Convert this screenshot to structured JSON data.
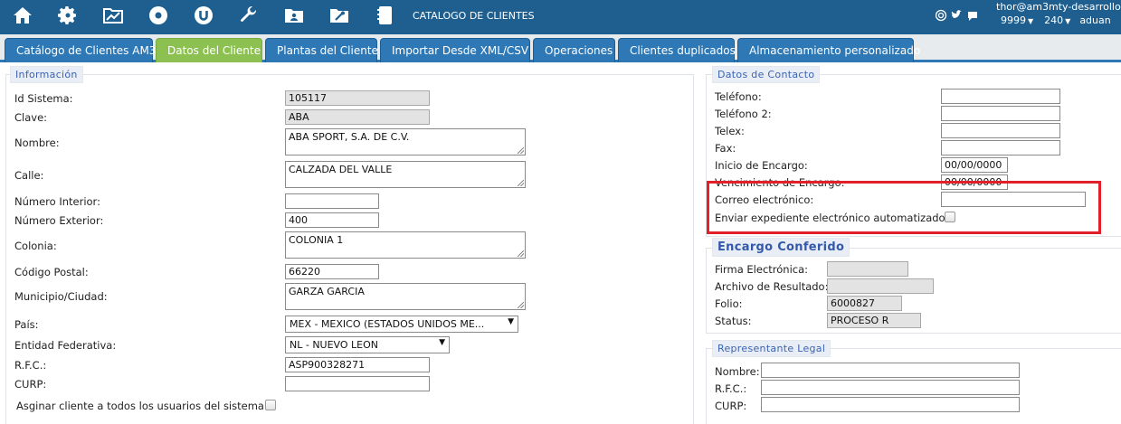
{
  "app": {
    "title": "CATALOGO DE CLIENTES"
  },
  "toolbar": {
    "icons": [
      "home-icon",
      "gear-icon",
      "chart-folder-icon",
      "record-icon",
      "u-circle-icon",
      "wrench-icon",
      "user-card-folder-icon",
      "tools-folder-icon",
      "notebook-icon"
    ]
  },
  "user": {
    "name": "thor@am3mty-desarrollo",
    "num1": "9999",
    "num2": "240",
    "extra": "aduan"
  },
  "tabs": [
    {
      "label": "Catálogo de Clientes AM3"
    },
    {
      "label": "Datos del Cliente",
      "active": true
    },
    {
      "label": "Plantas del Cliente"
    },
    {
      "label": "Importar Desde XML/CSV"
    },
    {
      "label": "Operaciones"
    },
    {
      "label": "Clientes duplicados"
    },
    {
      "label": "Almacenamiento personalizado"
    }
  ],
  "informacion": {
    "legend": "Información",
    "fields": {
      "id_sistema": {
        "label": "Id Sistema:",
        "value": "105117"
      },
      "clave": {
        "label": "Clave:",
        "value": "ABA"
      },
      "nombre": {
        "label": "Nombre:",
        "value": "ABA SPORT, S.A. DE C.V."
      },
      "calle": {
        "label": "Calle:",
        "value": "CALZADA DEL VALLE"
      },
      "num_interior": {
        "label": "Número Interior:",
        "value": ""
      },
      "num_exterior": {
        "label": "Número Exterior:",
        "value": "400"
      },
      "colonia": {
        "label": "Colonia:",
        "value": "COLONIA 1"
      },
      "codigo_postal": {
        "label": "Código Postal:",
        "value": "66220"
      },
      "municipio": {
        "label": "Municipio/Ciudad:",
        "value": "GARZA GARCIA"
      },
      "pais": {
        "label": "País:",
        "value": "MEX - MEXICO (ESTADOS UNIDOS ME..."
      },
      "entidad": {
        "label": "Entidad Federativa:",
        "value": "NL - NUEVO LEON"
      },
      "rfc": {
        "label": "R.F.C.:",
        "value": "ASP900328271"
      },
      "curp": {
        "label": "CURP:",
        "value": ""
      },
      "asignar": {
        "label": "Asginar cliente a todos los usuarios del sistema:"
      }
    }
  },
  "contacto": {
    "legend": "Datos de Contacto",
    "fields": {
      "telefono": {
        "label": "Teléfono:",
        "value": ""
      },
      "telefono2": {
        "label": "Teléfono 2:",
        "value": ""
      },
      "telex": {
        "label": "Telex:",
        "value": ""
      },
      "fax": {
        "label": "Fax:",
        "value": ""
      },
      "inicio": {
        "label": "Inicio de Encargo:",
        "value": "00/00/0000"
      },
      "vencimiento": {
        "label": "Vencimiento de Encargo:",
        "value": "00/00/0000"
      },
      "correo": {
        "label": "Correo electrónico:",
        "value": ""
      },
      "enviar": {
        "label": "Enviar expediente electrónico automatizado:"
      }
    }
  },
  "encargo": {
    "legend": "Encargo Conferido",
    "fields": {
      "firma": {
        "label": "Firma Electrónica:",
        "value": ""
      },
      "archivo": {
        "label": "Archivo de Resultado:",
        "value": ""
      },
      "folio": {
        "label": "Folio:",
        "value": "6000827"
      },
      "status": {
        "label": "Status:",
        "value": "PROCESO R"
      }
    }
  },
  "representante": {
    "legend": "Representante Legal",
    "fields": {
      "nombre": {
        "label": "Nombre:",
        "value": ""
      },
      "rfc": {
        "label": "R.F.C.:",
        "value": ""
      },
      "curp": {
        "label": "CURP:",
        "value": ""
      }
    }
  },
  "colors": {
    "topbar": "#1f5f90",
    "tab": "#2e78b6",
    "tab_active": "#8cc152",
    "highlight": "#e0202a"
  }
}
